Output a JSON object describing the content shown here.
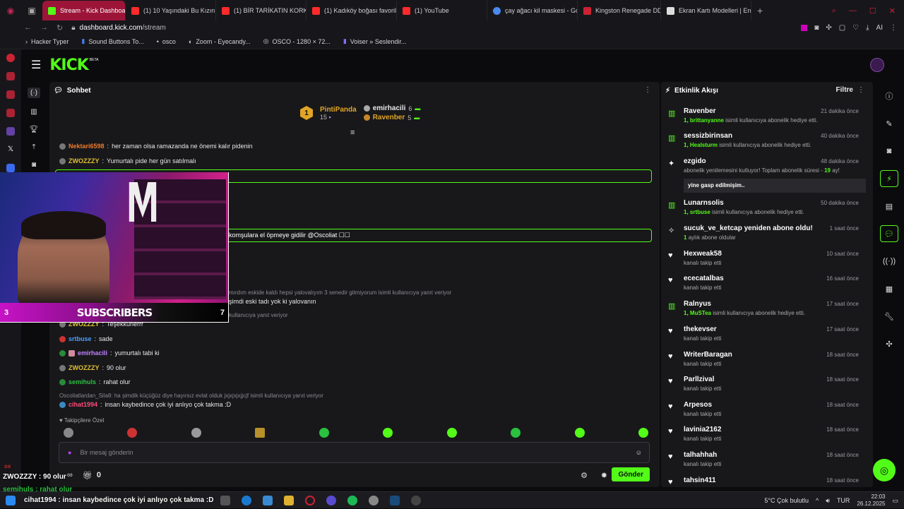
{
  "tabs": [
    {
      "label": "Stream - Kick Dashboard",
      "active": true,
      "color": "#53fc18"
    },
    {
      "label": "(1) 10 Yaşındaki Bu Kızın O",
      "color": "#ff2a2a"
    },
    {
      "label": "(1) BİR TARİKATIN KORKU",
      "color": "#ff2a2a"
    },
    {
      "label": "(1) Kadıköy boğası favorile",
      "color": "#ff2a2a"
    },
    {
      "label": "(1) YouTube",
      "color": "#ff2a2a"
    },
    {
      "label": "çay ağacı kil maskesi - Go",
      "color": "#4a8af0"
    },
    {
      "label": "Kingston Renegade DDR5",
      "color": "#c23"
    },
    {
      "label": "Ekran Kartı Modelleri | En",
      "color": "#ddd"
    }
  ],
  "address": {
    "host": "dashboard.kick.com",
    "path": "/stream",
    "ai": "AI"
  },
  "bookmarks": [
    "Hacker Typer",
    "Sound Buttons To...",
    "osco",
    "Zoom - Eyecandy...",
    "OSCO - 1280 × 72...",
    "Voiser » Seslendir..."
  ],
  "logo": {
    "text": "KICK",
    "beta": "BETA"
  },
  "chat": {
    "title": "Sohbet",
    "leaders": [
      {
        "rank": "1",
        "name": "PintiPanda",
        "count": "15",
        "color": "#e0a526"
      },
      {
        "name": "emirhacili",
        "count": "6",
        "color": "#ffffff"
      },
      {
        "name": "Ravenber",
        "count": "5",
        "color": "#e0a526"
      }
    ],
    "messages": [
      {
        "user": "Nektari6598",
        "text": "her zaman olsa ramazanda ne önemi kalır pidenin",
        "color": "#f07a2a"
      },
      {
        "user": "ZWOZZZY",
        "text": "Yumurtalı pide her gün satılmalı",
        "color": "#e0c030"
      }
    ],
    "highlight_text": "komşulara el öpmeye gidilir @Oscoliat ☐☐",
    "reply_partial": "mırdım eskide kaldı hepsi yalovalıyım 3 senedir gitmiyorum isimli kullanıcıya yanıt veriyor",
    "partial_msg": "şimdi eski tadı yok ki yalovanın",
    "reply_partial2": "kullanıcıya yanıt veriyor",
    "messages2": [
      {
        "user": "ZWOZZZY",
        "text": "Teşekkürlerrr",
        "color": "#e0c030"
      },
      {
        "user": "srtbuse",
        "text": "sade",
        "color": "#4aa0ff"
      },
      {
        "user": "emirhacili",
        "text": "yumurtalı tabi ki",
        "color": "#c080ff"
      },
      {
        "user": "ZWOZZZY",
        "text": "90 olur",
        "color": "#e0c030"
      },
      {
        "user": "semihuls",
        "text": "rahat olur",
        "color": "#2ac040"
      }
    ],
    "reply3": "Oscoliatlardan_Sila8: ha şimdik küçüğüz diye hayırsız evlat olduk jxjxjxjxjjcjf isimli kullanıcıya yanıt veriyor",
    "last_msg": {
      "user": "cihat1994",
      "text": "insan kaybedince çok iyi anlıyo çok takma :D",
      "color": "#ff4a7a"
    },
    "followers_label": "Takipçilere Özel",
    "input_placeholder": "Bir mesaj gönderin",
    "counter": "0",
    "send": "Gönder"
  },
  "webcam": {
    "subscribers_label": "SUBSCRIBERS",
    "left_count": "3",
    "right_count": "7"
  },
  "activity": {
    "title": "Etkinlik Akışı",
    "filter": "Filtre",
    "items": [
      {
        "name": "Ravenber",
        "time": "21 dakika önce",
        "num": "1,",
        "who": "brittanyanne",
        "rest": "isimli kullanıcıya abonelik hediye etti.",
        "icon": "gift"
      },
      {
        "name": "sessizbirinsan",
        "time": "40 dakika önce",
        "num": "1,",
        "who": "Healsturm",
        "rest": "isimli kullanıcıya abonelik hediye etti.",
        "icon": "gift"
      },
      {
        "name": "ezgido",
        "time": "48 dakika önce",
        "text": "abonelik yenilemesini kutluyor! Toplam abonelik süresi -",
        "months": "19",
        "unit": "ay!",
        "quote": "yine gasp edilmişim..",
        "icon": "party"
      },
      {
        "name": "Lunarnsolis",
        "time": "50 dakika önce",
        "num": "1,",
        "who": "srtbuse",
        "rest": "isimli kullanıcıya abonelik hediye etti.",
        "icon": "gift"
      },
      {
        "name": "sucuk_ve_ketcap yeniden abone oldu!",
        "time": "1 saat önce",
        "num": "1",
        "rest": "aylık abone oldular",
        "icon": "star"
      },
      {
        "name": "Hexweak58",
        "time": "10 saat önce",
        "rest": "kanalı takip etti",
        "icon": "heart"
      },
      {
        "name": "ececatalbas",
        "time": "16 saat önce",
        "rest": "kanalı takip etti",
        "icon": "heart"
      },
      {
        "name": "Ralnyus",
        "time": "17 saat önce",
        "num": "1,",
        "who": "MuSTea",
        "rest": "isimli kullanıcıya abonelik hediye etti.",
        "icon": "gift"
      },
      {
        "name": "thekevser",
        "time": "17 saat önce",
        "rest": "kanalı takip etti",
        "icon": "heart"
      },
      {
        "name": "WriterBaragan",
        "time": "18 saat önce",
        "rest": "kanalı takip etti",
        "icon": "heart"
      },
      {
        "name": "Parllzival",
        "time": "18 saat önce",
        "rest": "kanalı takip etti",
        "icon": "heart"
      },
      {
        "name": "Arpesos",
        "time": "18 saat önce",
        "rest": "kanalı takip etti",
        "icon": "heart"
      },
      {
        "name": "lavinia2162",
        "time": "18 saat önce",
        "rest": "kanalı takip etti",
        "icon": "heart"
      },
      {
        "name": "talhahhah",
        "time": "18 saat önce",
        "rest": "kanalı takip etti",
        "icon": "heart"
      },
      {
        "name": "tahsin411",
        "time": "18 saat önce",
        "rest": "",
        "icon": "heart"
      }
    ]
  },
  "overlay": {
    "line1": "ZWOZZZY : 90 olur",
    "line2": "semihuls : rahat olur",
    "line3": "cihat1994 : insan kaybedince çok iyi anlıyo çok takma :D",
    "tag": "ox"
  },
  "taskbar": {
    "weather": "5°C  Çok bulutlu",
    "lang": "TUR",
    "time": "22:03",
    "date": "26.12.2025"
  },
  "colors": {
    "accent": "#53fc18",
    "active_tab": "#9c1538"
  }
}
